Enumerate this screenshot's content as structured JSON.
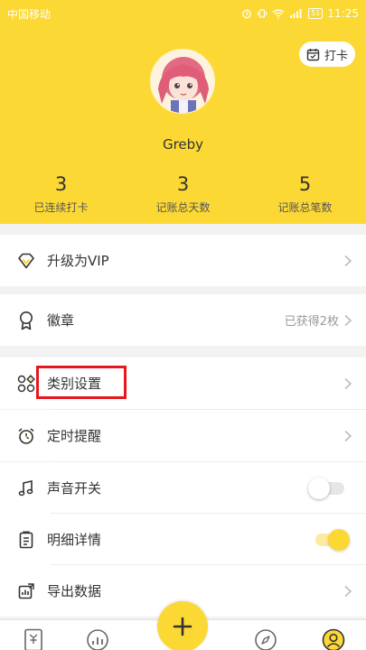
{
  "status_bar": {
    "carrier": "中国移动",
    "battery": "51",
    "time": "11:25"
  },
  "header": {
    "checkin_label": "打卡",
    "username": "Greby",
    "stats": [
      {
        "value": "3",
        "label": "已连续打卡"
      },
      {
        "value": "3",
        "label": "记账总天数"
      },
      {
        "value": "5",
        "label": "记账总笔数"
      }
    ]
  },
  "menu": {
    "vip": {
      "label": "升级为VIP"
    },
    "badges": {
      "label": "徽章",
      "value": "已获得2枚"
    },
    "category_settings": {
      "label": "类别设置"
    },
    "reminder": {
      "label": "定时提醒"
    },
    "sound": {
      "label": "声音开关",
      "enabled": false
    },
    "detail": {
      "label": "明细详情",
      "enabled": true
    },
    "export": {
      "label": "导出数据"
    }
  },
  "colors": {
    "accent": "#fcd834",
    "highlight": "#e8161e"
  },
  "tabbar": {
    "tabs": [
      "bill-icon",
      "chart-icon",
      "add-icon",
      "discover-icon",
      "profile-icon"
    ],
    "active": "profile-icon"
  }
}
